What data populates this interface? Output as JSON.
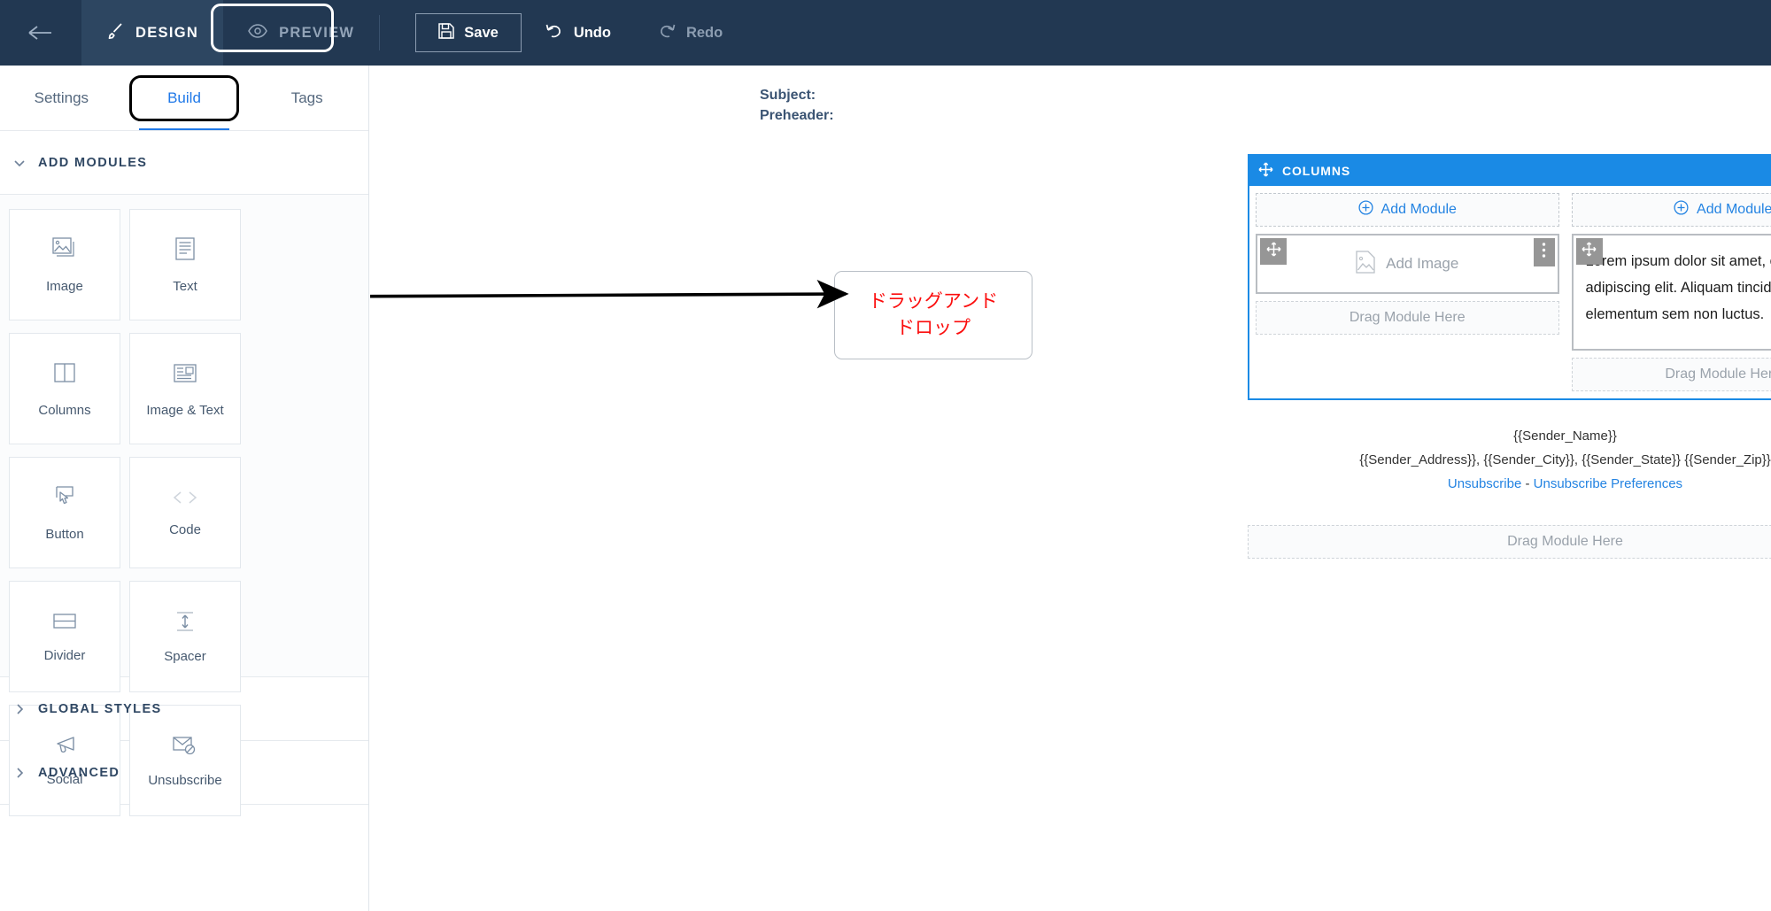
{
  "topbar": {
    "back_icon": "arrow-left-icon",
    "design": {
      "label": "DESIGN",
      "icon": "brush-icon"
    },
    "preview": {
      "label": "PREVIEW",
      "icon": "eye-icon"
    },
    "save": {
      "label": "Save",
      "icon": "save-disk-icon"
    },
    "undo": {
      "label": "Undo",
      "icon": "undo-arrow-icon"
    },
    "redo": {
      "label": "Redo",
      "icon": "redo-arrow-icon"
    },
    "accent_bg": "#223852",
    "active_bg": "#2d4661"
  },
  "sidebar": {
    "tabs": [
      {
        "label": "Settings",
        "active": false
      },
      {
        "label": "Build",
        "active": true
      },
      {
        "label": "Tags",
        "active": false
      }
    ],
    "active_tab_color": "#2079e8",
    "sections": [
      {
        "label": "ADD MODULES",
        "expanded": true
      },
      {
        "label": "GLOBAL STYLES",
        "expanded": false
      },
      {
        "label": "ADVANCED",
        "expanded": false
      }
    ],
    "modules": [
      {
        "label": "Image",
        "icon": "image-stack-icon"
      },
      {
        "label": "Text",
        "icon": "text-lines-icon"
      },
      {
        "label": "Columns",
        "icon": "two-columns-icon"
      },
      {
        "label": "Image & Text",
        "icon": "image-text-icon"
      },
      {
        "label": "Button",
        "icon": "pointer-button-icon"
      },
      {
        "label": "Code",
        "icon": "angle-brackets-icon"
      },
      {
        "label": "Divider",
        "icon": "divider-icon"
      },
      {
        "label": "Spacer",
        "icon": "vertical-arrow-icon"
      },
      {
        "label": "Social",
        "icon": "megaphone-icon"
      },
      {
        "label": "Unsubscribe",
        "icon": "envelope-block-icon"
      }
    ]
  },
  "canvas": {
    "subject_label": "Subject:",
    "preheader_label": "Preheader:",
    "annotation": {
      "line1": "ドラッグアンド",
      "line2": "ドロップ",
      "color": "#fb0d0d"
    }
  },
  "email": {
    "columns_module": {
      "title": "COLUMNS",
      "drag_icon": "move-cross-icon",
      "duplicate_icon": "copy-icon",
      "delete_icon": "trash-icon",
      "selected_color": "#1a8ae5",
      "left_column": {
        "add_module_label": "Add Module",
        "add_module_icon": "plus-circle-icon",
        "image_module": {
          "placeholder": "Add Image",
          "icon": "image-placeholder-icon",
          "drag_icon": "move-cross-icon",
          "kebab_icon": "kebab-menu-icon"
        },
        "drop_label": "Drag Module Here"
      },
      "right_column": {
        "add_module_label": "Add Module",
        "add_module_icon": "plus-circle-icon",
        "text_module": {
          "content": "Lorem ipsum dolor sit amet, consectetur adipiscing elit. Aliquam tincidunt elementum sem non luctus.",
          "drag_icon": "move-cross-icon",
          "kebab_icon": "kebab-menu-icon"
        },
        "drop_label": "Drag Module Here"
      }
    },
    "footer": {
      "sender_name": "{{Sender_Name}}",
      "sender_address": "{{Sender_Address}}, {{Sender_City}}, {{Sender_State}} {{Sender_Zip}}",
      "unsubscribe_label": "Unsubscribe",
      "separator": " - ",
      "unsubscribe_prefs_label": "Unsubscribe Preferences",
      "link_color": "#2383e2"
    },
    "bottom_drop_label": "Drag Module Here"
  }
}
